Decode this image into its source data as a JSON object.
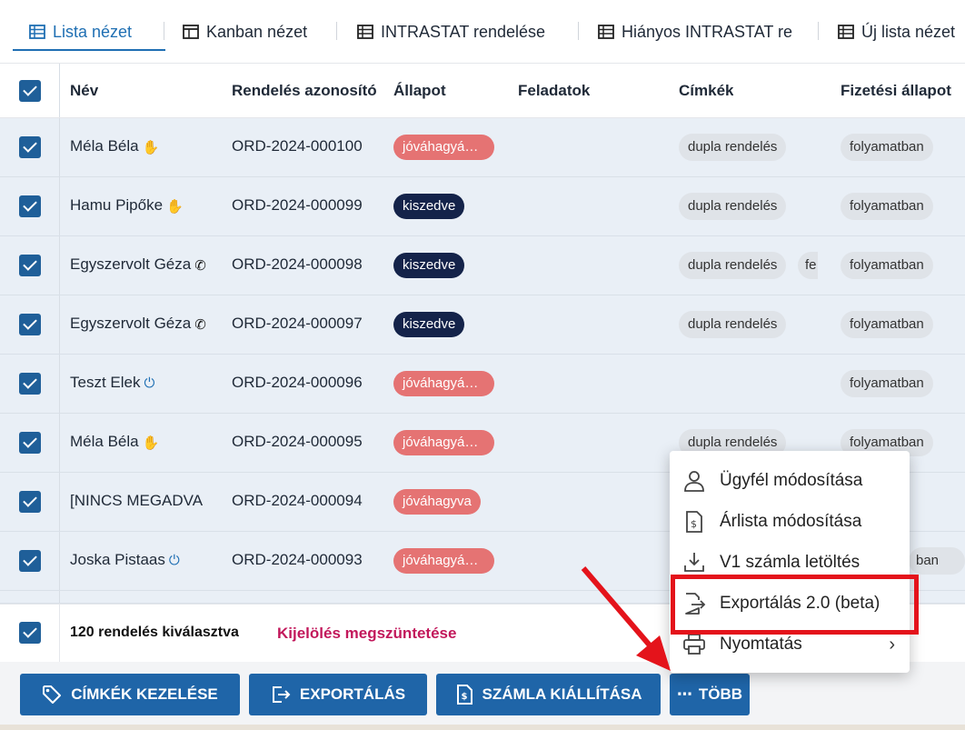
{
  "tabs": [
    {
      "label": "Lista nézet",
      "icon": "list-icon",
      "active": true
    },
    {
      "label": "Kanban nézet",
      "icon": "kanban-icon"
    },
    {
      "label": "INTRASTAT rendelése",
      "icon": "list-icon"
    },
    {
      "label": "Hiányos INTRASTAT re",
      "icon": "list-icon"
    },
    {
      "label": "Új lista nézet",
      "icon": "list-icon"
    }
  ],
  "columns": {
    "name": "Név",
    "order_id": "Rendelés azonosító",
    "status": "Állapot",
    "tasks": "Feladatok",
    "tags": "Címkék",
    "payment": "Fizetési állapot"
  },
  "rows": [
    {
      "name": "Méla Béla",
      "name_icon": "hand-icon",
      "order_id": "ORD-2024-000100",
      "status": "jóváhagyá…",
      "status_color": "red",
      "tags": [
        "dupla rendelés"
      ],
      "payment": "folyamatban"
    },
    {
      "name": "Hamu Pipőke",
      "name_icon": "hand-icon",
      "order_id": "ORD-2024-000099",
      "status": "kiszedve",
      "status_color": "navy",
      "tags": [
        "dupla rendelés"
      ],
      "payment": "folyamatban"
    },
    {
      "name": "Egyszervolt Géza",
      "name_icon": "phone-icon",
      "order_id": "ORD-2024-000098",
      "status": "kiszedve",
      "status_color": "navy",
      "tags": [
        "dupla rendelés",
        "fe"
      ],
      "payment": "folyamatban"
    },
    {
      "name": "Egyszervolt Géza",
      "name_icon": "phone-icon",
      "order_id": "ORD-2024-000097",
      "status": "kiszedve",
      "status_color": "navy",
      "tags": [
        "dupla rendelés"
      ],
      "payment": "folyamatban"
    },
    {
      "name": "Teszt Elek",
      "name_icon": "power-icon",
      "order_id": "ORD-2024-000096",
      "status": "jóváhagyá…",
      "status_color": "red",
      "tags": [],
      "payment": "folyamatban"
    },
    {
      "name": "Méla Béla",
      "name_icon": "hand-icon",
      "order_id": "ORD-2024-000095",
      "status": "jóváhagyá…",
      "status_color": "red",
      "tags": [
        "dupla rendelés"
      ],
      "payment": "folyamatban"
    },
    {
      "name": "[NINCS MEGADVA",
      "name_icon": "",
      "order_id": "ORD-2024-000094",
      "status": "jóváhagyva",
      "status_color": "red",
      "tags": [],
      "payment": ""
    },
    {
      "name": "Joska Pistaas",
      "name_icon": "power-icon",
      "order_id": "ORD-2024-000093",
      "status": "jóváhagyá…",
      "status_color": "red",
      "tags": [],
      "payment": "ban"
    }
  ],
  "selection": {
    "count_text": "120 rendelés kiválasztva",
    "clear_label": "Kijelölés megszüntetése"
  },
  "actions": {
    "tags_label": "CÍMKÉK KEZELÉSE",
    "export_label": "EXPORTÁLÁS",
    "invoice_label": "SZÁMLA KIÁLLÍTÁSA",
    "more_label": "TÖBB"
  },
  "menu": {
    "items": [
      {
        "label": "Ügyfél módosítása",
        "icon": "person-icon"
      },
      {
        "label": "Árlista módosítása",
        "icon": "price-document-icon"
      },
      {
        "label": "V1 számla letöltés",
        "icon": "download-icon"
      },
      {
        "label": "Exportálás 2.0 (beta)",
        "icon": "export-icon",
        "highlighted": true
      },
      {
        "label": "Nyomtatás",
        "icon": "printer-icon",
        "submenu": true
      }
    ]
  },
  "colors": {
    "primary": "#1f65a8",
    "row_bg": "#e9eff6",
    "status_red": "#e57373",
    "status_navy": "#14234a",
    "clear_link": "#c2185b",
    "highlight": "#e4131b"
  }
}
